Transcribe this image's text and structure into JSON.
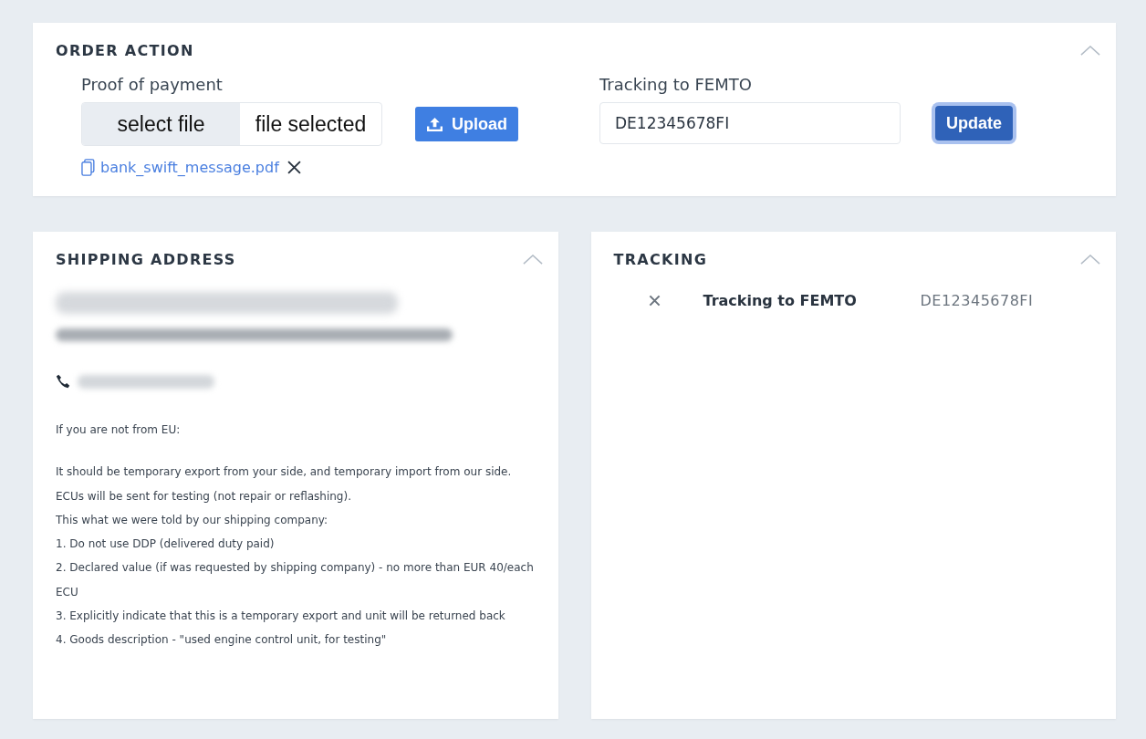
{
  "order_action": {
    "title": "ORDER ACTION",
    "expanded": true,
    "proof": {
      "label": "Proof of payment",
      "select_button": "select file",
      "status": "file selected",
      "upload_button": "Upload",
      "file": "bank_swift_message.pdf"
    },
    "tracking": {
      "label": "Tracking to FEMTO",
      "value": "DE12345678FI",
      "update_button": "Update"
    }
  },
  "shipping_address": {
    "title": "SHIPPING ADDRESS",
    "expanded": true,
    "notes": [
      {
        "text": "If you are not from EU:",
        "spaced": false
      },
      {
        "text": "It should be temporary export from your side, and temporary import from our side.",
        "spaced": true
      },
      {
        "text": "ECUs will be sent for testing (not repair or reflashing).",
        "spaced": false
      },
      {
        "text": "This what we were told by our shipping company:",
        "spaced": false
      },
      {
        "text": "1. Do not use DDP (delivered duty paid)",
        "spaced": false
      },
      {
        "text": "2. Declared value (if was requested by shipping company) - no more than EUR 40/each ECU",
        "spaced": false
      },
      {
        "text": "3. Explicitly indicate that this is a temporary export and unit will be returned back",
        "spaced": false
      },
      {
        "text": "4. Goods description - \"used engine control unit, for testing\"",
        "spaced": false
      }
    ]
  },
  "tracking": {
    "title": "TRACKING",
    "expanded": true,
    "rows": [
      {
        "label": "Tracking to FEMTO",
        "value": "DE12345678FI"
      }
    ]
  }
}
